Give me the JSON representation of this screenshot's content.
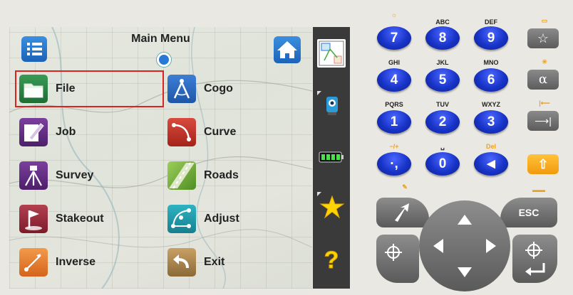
{
  "screen": {
    "title": "Main Menu",
    "items": [
      {
        "label": "File",
        "icon": "folder-icon"
      },
      {
        "label": "Cogo",
        "icon": "compass-icon"
      },
      {
        "label": "Job",
        "icon": "job-icon"
      },
      {
        "label": "Curve",
        "icon": "curve-icon"
      },
      {
        "label": "Survey",
        "icon": "tripod-icon"
      },
      {
        "label": "Roads",
        "icon": "road-icon"
      },
      {
        "label": "Stakeout",
        "icon": "flag-icon"
      },
      {
        "label": "Adjust",
        "icon": "adjust-icon"
      },
      {
        "label": "Inverse",
        "icon": "inverse-icon"
      },
      {
        "label": "Exit",
        "icon": "exit-icon"
      }
    ],
    "selected": "File"
  },
  "keypad": {
    "keys": [
      {
        "label": "7",
        "top": ""
      },
      {
        "label": "8",
        "top": "ABC"
      },
      {
        "label": "9",
        "top": "DEF"
      },
      {
        "label": "4",
        "top": "GHI"
      },
      {
        "label": "5",
        "top": "JKL"
      },
      {
        "label": "6",
        "top": "MNO"
      },
      {
        "label": "1",
        "top": "PQRS"
      },
      {
        "label": "2",
        "top": "TUV"
      },
      {
        "label": "3",
        "top": "WXYZ"
      },
      {
        "label": "·,",
        "top": "−/+"
      },
      {
        "label": "0",
        "top": "␣"
      },
      {
        "label": "◀",
        "top": "Del"
      }
    ],
    "side_keys": {
      "star": "☆",
      "alpha": "α",
      "tab": "⟶|",
      "shift": "⇧"
    },
    "esc": "ESC"
  },
  "colors": {
    "accent_blue": "#1834c8",
    "orange": "#f29a0e",
    "selection_red": "#d22222"
  }
}
